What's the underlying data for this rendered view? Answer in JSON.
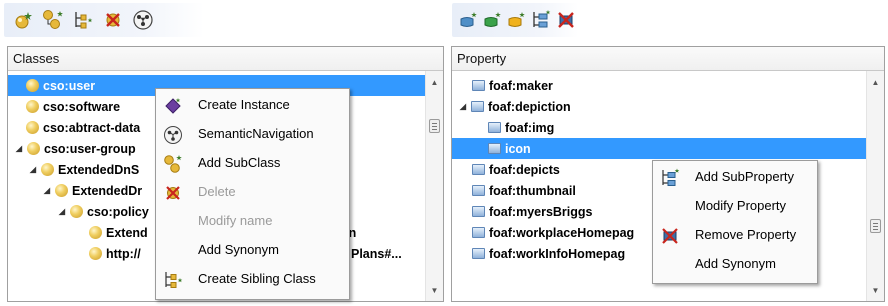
{
  "left_toolbar": {
    "buttons": [
      {
        "icon": "create-instance-icon"
      },
      {
        "icon": "add-subclass-icon"
      },
      {
        "icon": "create-sibling-class-icon"
      },
      {
        "icon": "delete-class-icon"
      },
      {
        "icon": "semantic-navigation-icon"
      }
    ]
  },
  "right_toolbar": {
    "buttons": [
      {
        "icon": "add-property-blue-icon"
      },
      {
        "icon": "add-property-green-icon"
      },
      {
        "icon": "add-property-orange-icon"
      },
      {
        "icon": "add-subproperty-icon"
      },
      {
        "icon": "remove-property-icon"
      }
    ]
  },
  "classes_panel": {
    "title": "Classes",
    "rows": [
      {
        "label": "cso:user",
        "selected": true
      },
      {
        "label": "cso:software"
      },
      {
        "label": "cso:abtract-data"
      },
      {
        "label": "cso:user-group",
        "expander": "◢"
      },
      {
        "label": "ExtendedDnS",
        "expander": "◢"
      },
      {
        "label": "ExtendedDr",
        "expander": "◢"
      },
      {
        "label": "cso:policy",
        "expander": "◢"
      },
      {
        "label": "Extend",
        "tail": "on"
      },
      {
        "label": "http://",
        "tail": "Plans#..."
      }
    ]
  },
  "class_menu": {
    "items": [
      {
        "label": "Create Instance",
        "icon": "create-instance-icon",
        "disabled": false
      },
      {
        "label": "SemanticNavigation",
        "icon": "semantic-navigation-icon",
        "disabled": false
      },
      {
        "label": "Add SubClass",
        "icon": "add-subclass-icon",
        "disabled": false
      },
      {
        "label": "Delete",
        "icon": "delete-icon",
        "disabled": true
      },
      {
        "label": "Modify name",
        "icon": "",
        "disabled": true
      },
      {
        "label": "Add Synonym",
        "icon": "",
        "disabled": false
      },
      {
        "label": "Create Sibling Class",
        "icon": "create-sibling-class-icon",
        "disabled": false
      }
    ]
  },
  "property_panel": {
    "title": "Property",
    "rows": [
      {
        "label": "foaf:maker"
      },
      {
        "label": "foaf:depiction",
        "expander": "◢"
      },
      {
        "label": "foaf:img"
      },
      {
        "label": "icon",
        "selected": true
      },
      {
        "label": "foaf:depicts"
      },
      {
        "label": "foaf:thumbnail"
      },
      {
        "label": "foaf:myersBriggs"
      },
      {
        "label": "foaf:workplaceHomepag"
      },
      {
        "label": "foaf:workInfoHomepag"
      }
    ]
  },
  "prop_menu": {
    "items": [
      {
        "label": "Add SubProperty",
        "icon": "add-subproperty-icon"
      },
      {
        "label": "Modify Property",
        "icon": ""
      },
      {
        "label": "Remove Property",
        "icon": "remove-property-icon"
      },
      {
        "label": "Add Synonym",
        "icon": ""
      }
    ]
  },
  "scroll_glyphs": {
    "up": "▲",
    "down": "▼"
  }
}
